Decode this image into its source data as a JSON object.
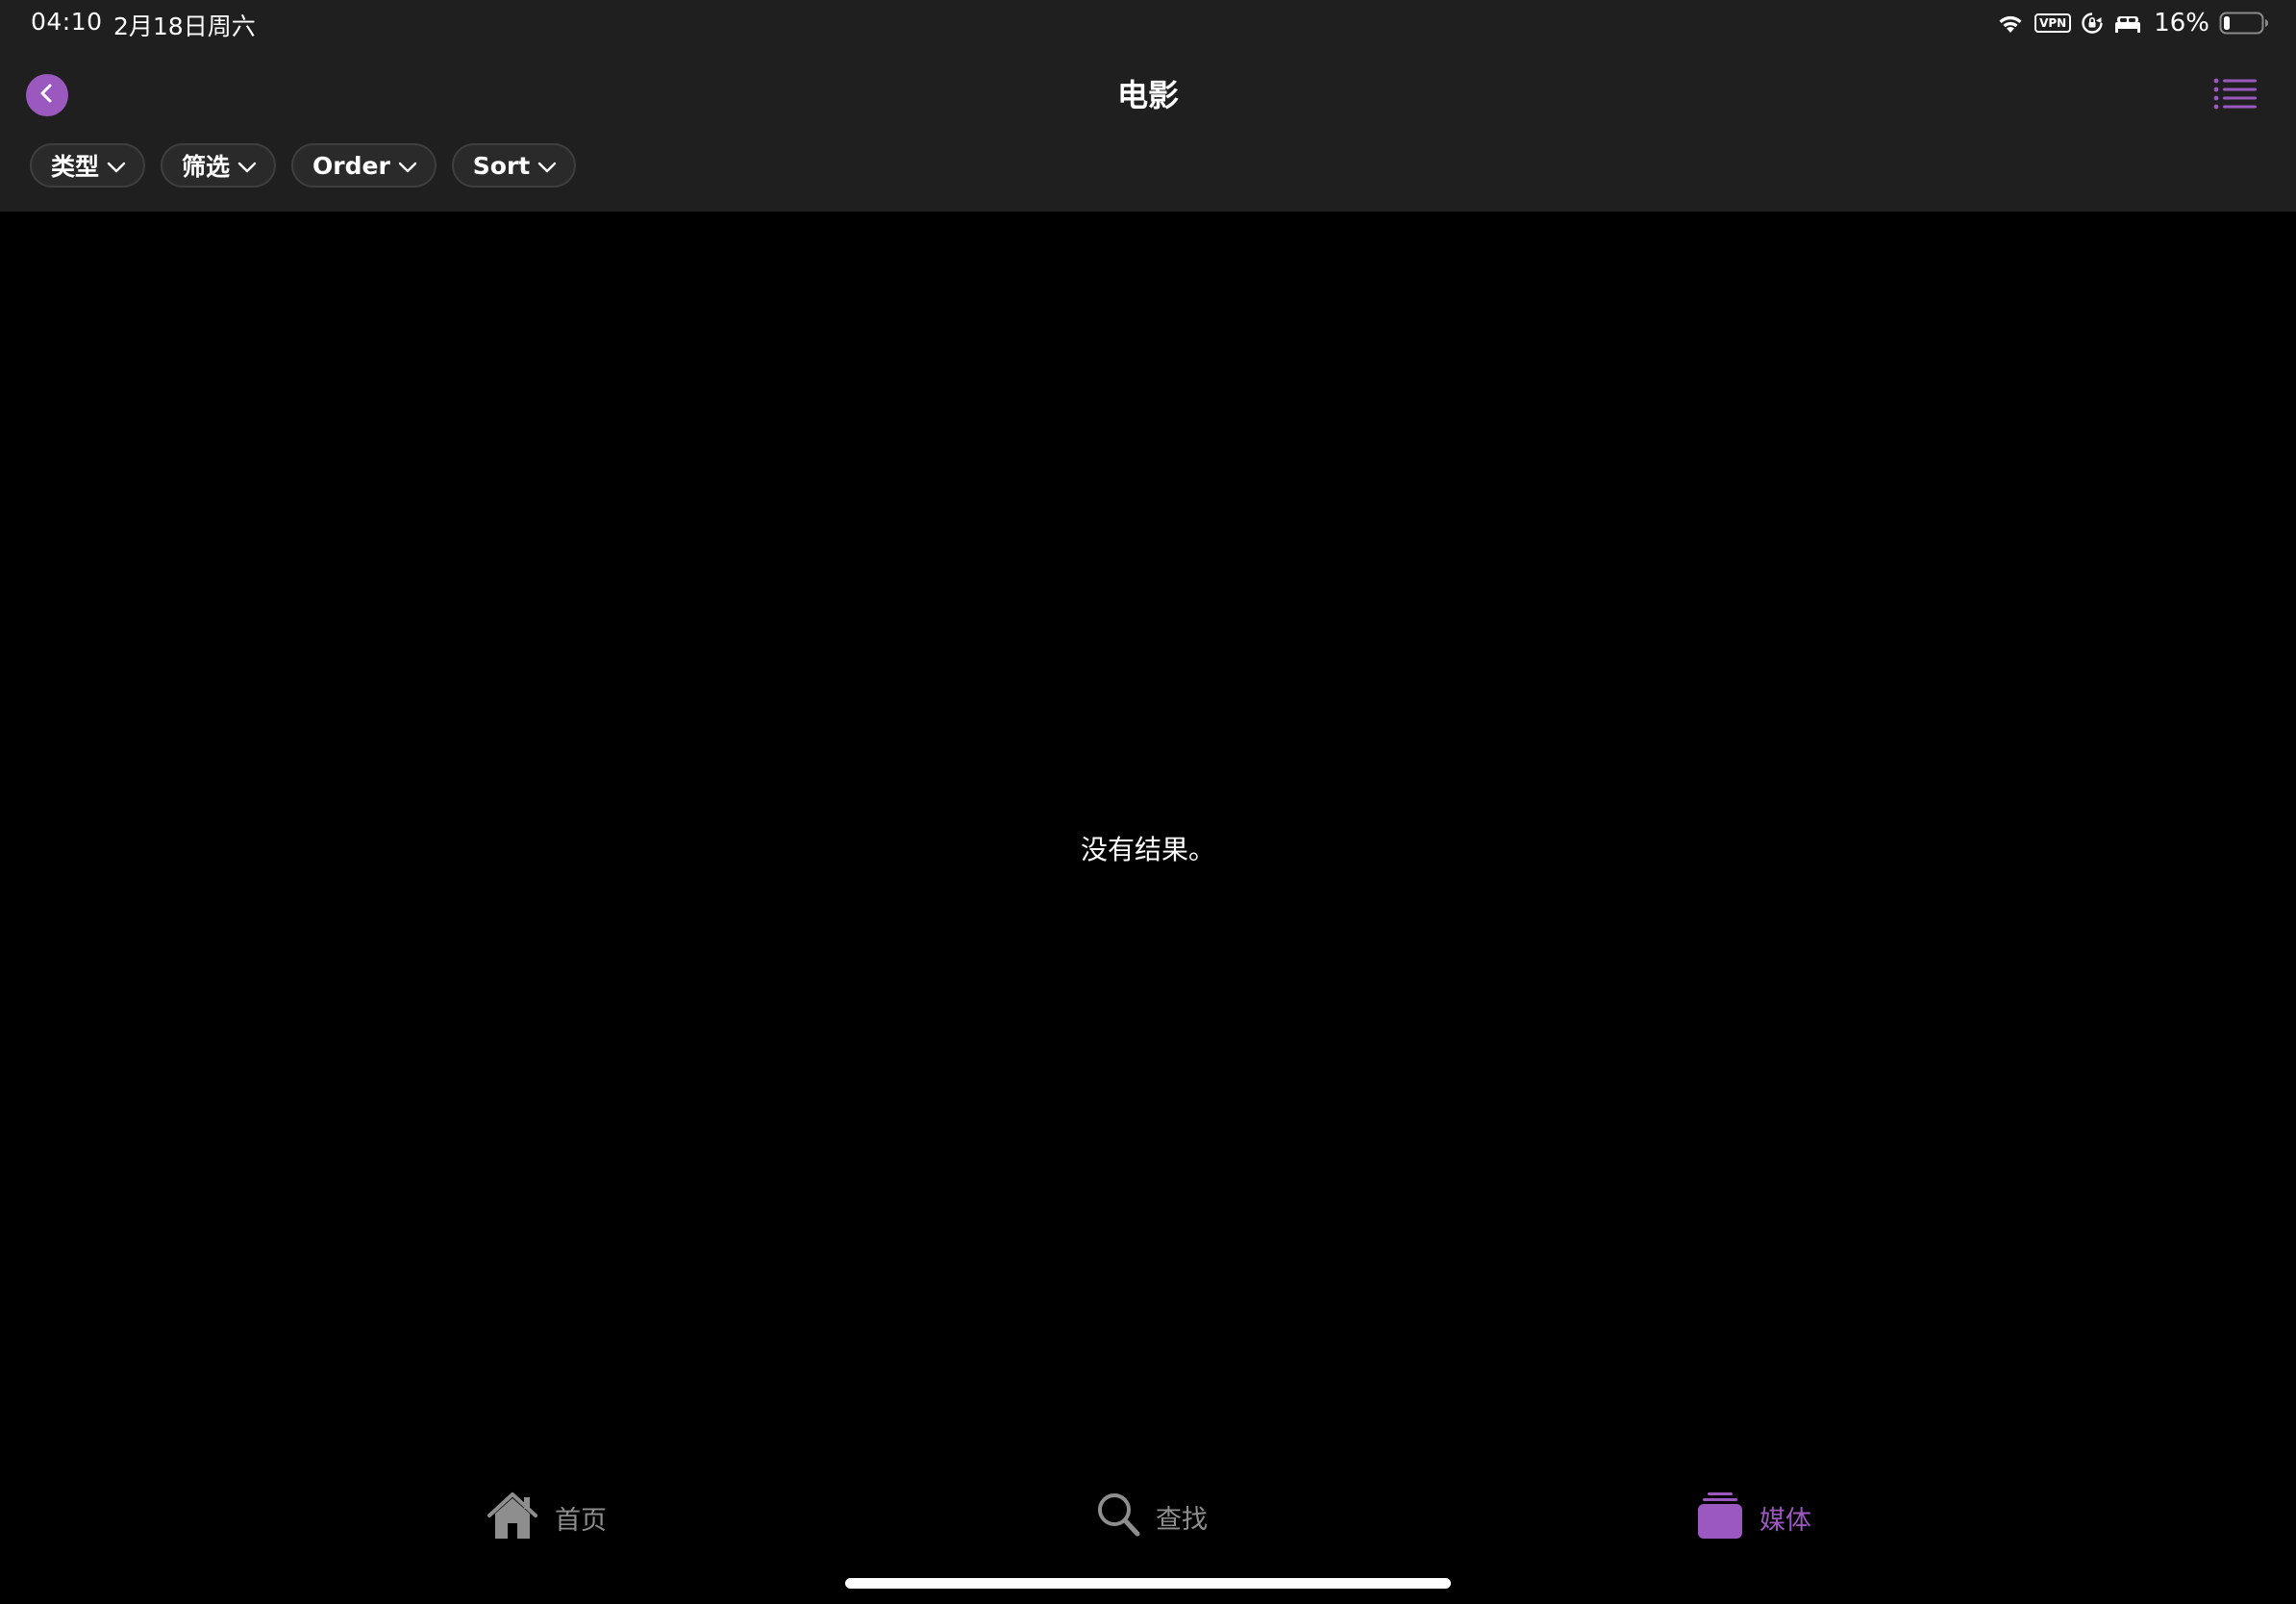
{
  "status_bar": {
    "time": "04:10",
    "date": "2月18日周六",
    "vpn_label": "VPN",
    "battery_percent": "16%",
    "battery_level": 0.16,
    "icons": [
      "wifi-icon",
      "vpn-icon",
      "orientation-lock-icon",
      "sleep-focus-icon",
      "battery-icon"
    ]
  },
  "nav": {
    "title": "电影",
    "back_icon": "chevron-left-icon",
    "menu_icon": "list-icon"
  },
  "filters": [
    {
      "label": "类型"
    },
    {
      "label": "筛选"
    },
    {
      "label": "Order"
    },
    {
      "label": "Sort"
    }
  ],
  "main": {
    "empty_text": "没有结果。"
  },
  "tabs": [
    {
      "label": "首页",
      "icon": "house-icon",
      "active": false
    },
    {
      "label": "查找",
      "icon": "search-icon",
      "active": false
    },
    {
      "label": "媒体",
      "icon": "media-stack-icon",
      "active": true
    }
  ],
  "colors": {
    "accent": "#9b59c0",
    "chrome_background": "#1f1f1f",
    "background": "#000000",
    "inactive_tab": "#8e8e8e"
  }
}
